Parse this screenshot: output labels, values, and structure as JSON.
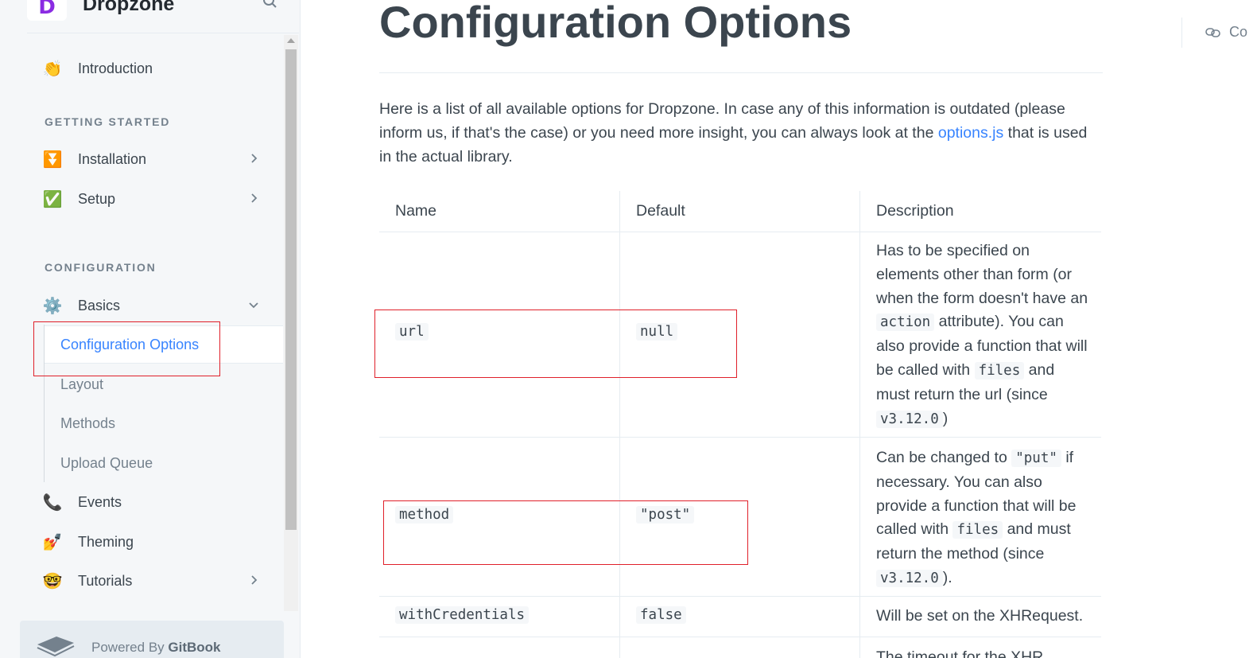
{
  "brand": {
    "name": "Dropzone",
    "logo_letter": "D"
  },
  "sidebar": {
    "intro": {
      "emoji": "👏",
      "label": "Introduction"
    },
    "section_getting_started": "GETTING STARTED",
    "installation": {
      "emoji": "⏬",
      "label": "Installation"
    },
    "setup": {
      "emoji": "✅",
      "label": "Setup"
    },
    "section_configuration": "CONFIGURATION",
    "basics": {
      "emoji": "⚙️",
      "label": "Basics"
    },
    "basics_children": [
      "Configuration Options",
      "Layout",
      "Methods",
      "Upload Queue"
    ],
    "events": {
      "emoji": "📞",
      "label": "Events"
    },
    "theming": {
      "emoji": "💅",
      "label": "Theming"
    },
    "tutorials": {
      "emoji": "🤓",
      "label": "Tutorials"
    },
    "powered_prefix": "Powered By ",
    "powered_brand": "GitBook"
  },
  "page": {
    "title": "Configuration Options",
    "intro_before": "Here is a list of all available options for Dropzone. In case any of this information is outdated (please inform us, if that's the case) or you need more insight, you can always look at the ",
    "intro_link": "options.js",
    "intro_after": " that is used in the actual library.",
    "right_link": "Co"
  },
  "table": {
    "headers": [
      "Name",
      "Default",
      "Description"
    ],
    "rows": [
      {
        "name": "url",
        "default": "null"
      },
      {
        "name": "method",
        "default": "\"post\""
      },
      {
        "name": "withCredentials",
        "default": "false",
        "description": "Will be set on the XHRequest."
      }
    ],
    "url_desc": {
      "t1": "Has to be specified on elements other than form (or when the form doesn't have an ",
      "c1": "action",
      "t2": " attribute). You can also provide a function that will be called with ",
      "c2": "files",
      "t3": " and must return the url (since ",
      "c3": "v3.12.0",
      "t4": ")"
    },
    "method_desc": {
      "t1": "Can be changed to ",
      "c1": "\"put\"",
      "t2": " if necessary. You can also provide a function that will be called with ",
      "c2": "files",
      "t3": " and must return the method (since ",
      "c3": "v3.12.0",
      "t4": ")."
    },
    "next_row_partial": "The timeout for the XHR"
  },
  "colors": {
    "accent": "#3884ff",
    "highlight": "#e0202a",
    "text": "#3b454e",
    "muted": "#74818d"
  }
}
